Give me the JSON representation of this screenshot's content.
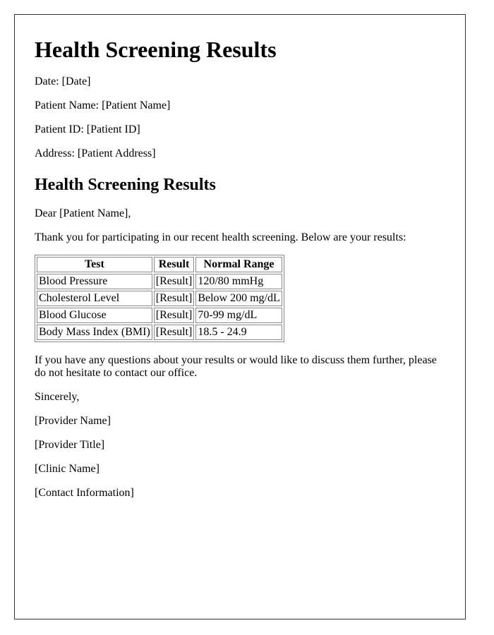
{
  "document": {
    "title": "Health Screening Results",
    "fields": [
      "Date: [Date]",
      "Patient Name: [Patient Name]",
      "Patient ID: [Patient ID]",
      "Address: [Patient Address]"
    ],
    "section_title": "Health Screening Results",
    "salutation": "Dear [Patient Name],",
    "intro": "Thank you for participating in our recent health screening. Below are your results:",
    "table": {
      "headers": [
        "Test",
        "Result",
        "Normal Range"
      ],
      "rows": [
        [
          "Blood Pressure",
          "[Result]",
          "120/80 mmHg"
        ],
        [
          "Cholesterol Level",
          "[Result]",
          "Below 200 mg/dL"
        ],
        [
          "Blood Glucose",
          "[Result]",
          "70-99 mg/dL"
        ],
        [
          "Body Mass Index (BMI)",
          "[Result]",
          "18.5 - 24.9"
        ]
      ]
    },
    "closing_paragraph": "If you have any questions about your results or would like to discuss them further, please do not hesitate to contact our office.",
    "signoff": "Sincerely,",
    "signature": [
      "[Provider Name]",
      "[Provider Title]",
      "[Clinic Name]",
      "[Contact Information]"
    ]
  }
}
